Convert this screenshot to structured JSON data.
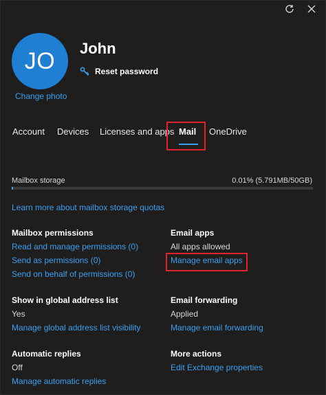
{
  "header": {
    "refresh_icon": "refresh-icon",
    "close_icon": "close-icon"
  },
  "profile": {
    "initials": "JO",
    "name": "John",
    "change_photo": "Change photo",
    "reset_password": "Reset password",
    "avatar_color": "#1e7fd3"
  },
  "tabs": [
    {
      "label": "Account"
    },
    {
      "label": "Devices"
    },
    {
      "label": "Licenses and apps"
    },
    {
      "label": "Mail",
      "active": true
    },
    {
      "label": "OneDrive"
    }
  ],
  "storage": {
    "label": "Mailbox storage",
    "value": "0.01% (5.791MB/50GB)",
    "used_fraction": 0.0001
  },
  "learn_more": "Learn more about mailbox storage quotas",
  "mailbox_permissions": {
    "title": "Mailbox permissions",
    "items": [
      "Read and manage permissions (0)",
      "Send as permissions (0)",
      "Send on behalf of permissions (0)"
    ]
  },
  "email_apps": {
    "title": "Email apps",
    "status": "All apps allowed",
    "link": "Manage email apps"
  },
  "global_address": {
    "title": "Show in global address list",
    "status": "Yes",
    "link": "Manage global address list visibility"
  },
  "email_forwarding": {
    "title": "Email forwarding",
    "status": "Applied",
    "link": "Manage email forwarding"
  },
  "automatic_replies": {
    "title": "Automatic replies",
    "status": "Off",
    "link": "Manage automatic replies"
  },
  "more_actions": {
    "title": "More actions",
    "link": "Edit Exchange properties"
  },
  "colors": {
    "accent": "#3aa0f3",
    "highlight": "#e0242f",
    "background": "#1f1e1d"
  }
}
